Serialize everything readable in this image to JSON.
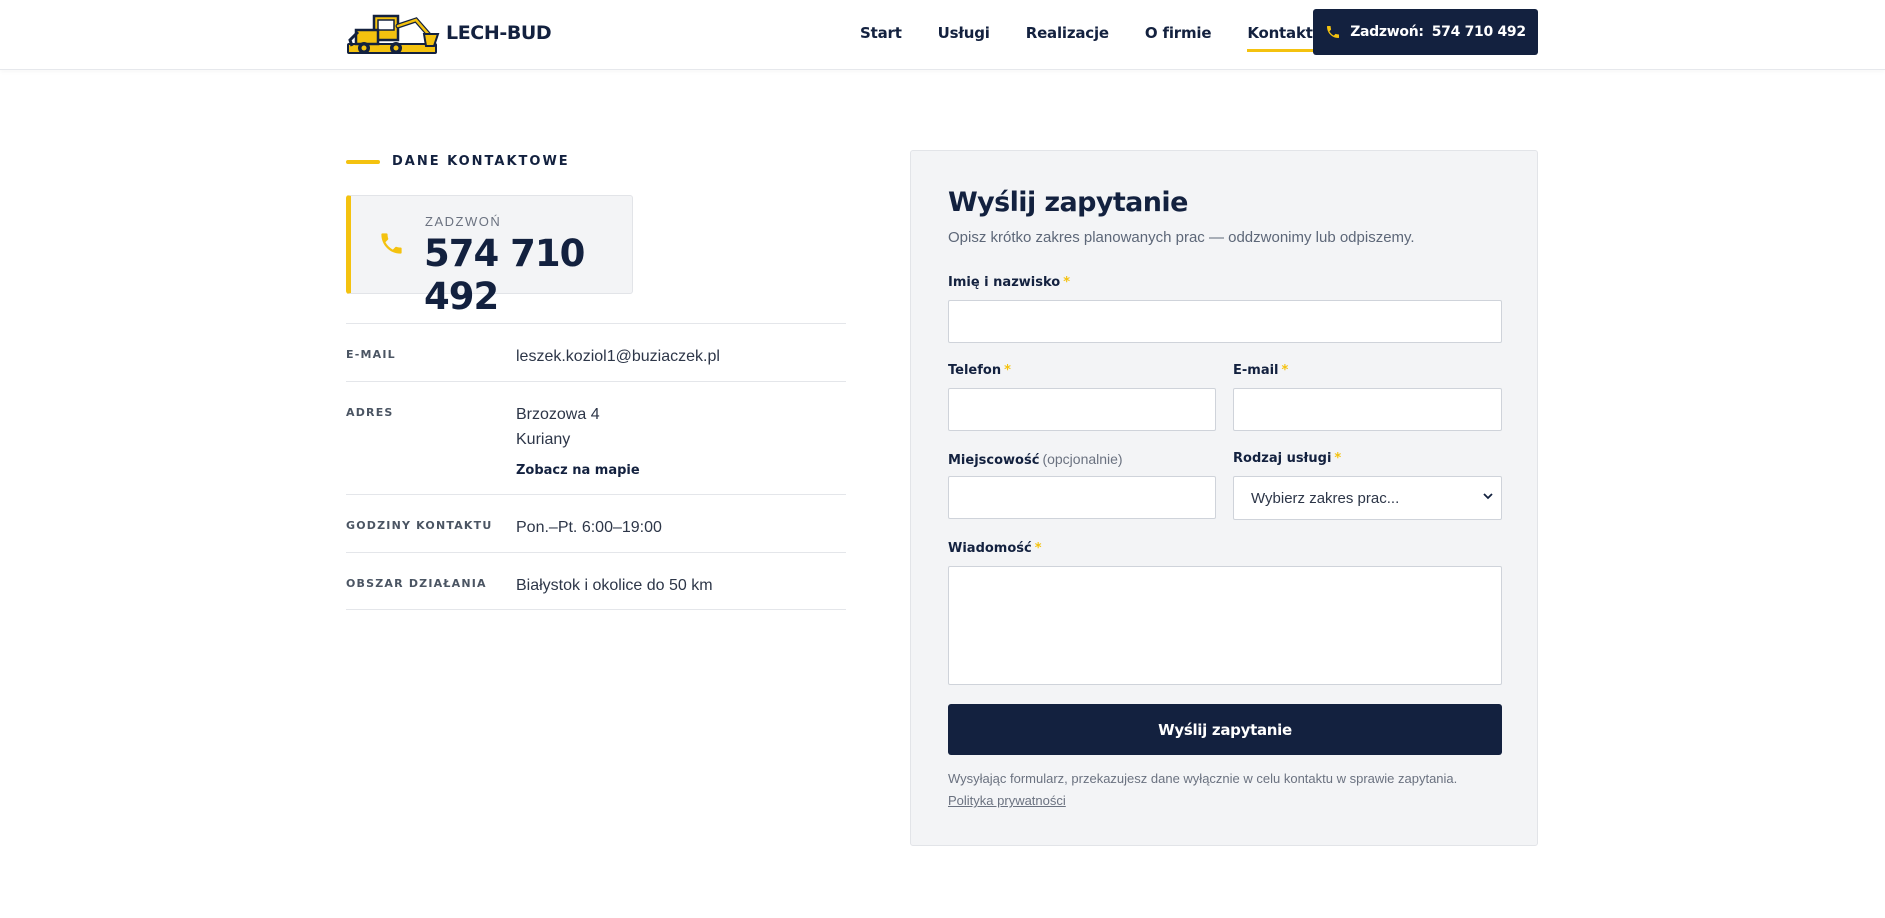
{
  "brand": {
    "name": "LECH-BUD"
  },
  "nav": {
    "items": [
      {
        "label": "Start"
      },
      {
        "label": "Usługi"
      },
      {
        "label": "Realizacje"
      },
      {
        "label": "O firmie"
      },
      {
        "label": "Kontakt",
        "active": true
      }
    ]
  },
  "header_cta": {
    "label": "Zadzwoń:",
    "number": "574 710 492"
  },
  "contact": {
    "kicker": "DANE KONTAKTOWE",
    "phone_label": "ZADZWOŃ",
    "phone_number": "574 710 492",
    "rows": [
      {
        "label": "E-MAIL",
        "value": "leszek.koziol1@buziaczek.pl"
      },
      {
        "label": "ADRES",
        "line1": "Brzozowa 4",
        "line2": "Kuriany",
        "link": "Zobacz na mapie"
      },
      {
        "label": "GODZINY KONTAKTU",
        "value": "Pon.–Pt. 6:00–19:00"
      },
      {
        "label": "OBSZAR DZIAŁANIA",
        "value": "Białystok i okolice do 50 km"
      }
    ]
  },
  "form": {
    "title": "Wyślij zapytanie",
    "subtitle": "Opisz krótko zakres planowanych prac — oddzwonimy lub odpiszemy.",
    "fields": {
      "name_label": "Imię i nazwisko",
      "phone_label": "Telefon",
      "email_label": "E-mail",
      "city_label": "Miejscowość",
      "city_optional": "(opcjonalnie)",
      "service_label": "Rodzaj usługi",
      "service_selected": "Wybierz zakres prac...",
      "message_label": "Wiadomość",
      "required_mark": "*"
    },
    "submit_label": "Wyślij zapytanie",
    "note": "Wysyłając formularz, przekazujesz dane wyłącznie w celu kontaktu w sprawie zapytania.",
    "policy_link": "Polityka prywatności"
  },
  "colors": {
    "navy": "#13213f",
    "accent": "#f4c20f",
    "panel": "#f3f4f6"
  }
}
